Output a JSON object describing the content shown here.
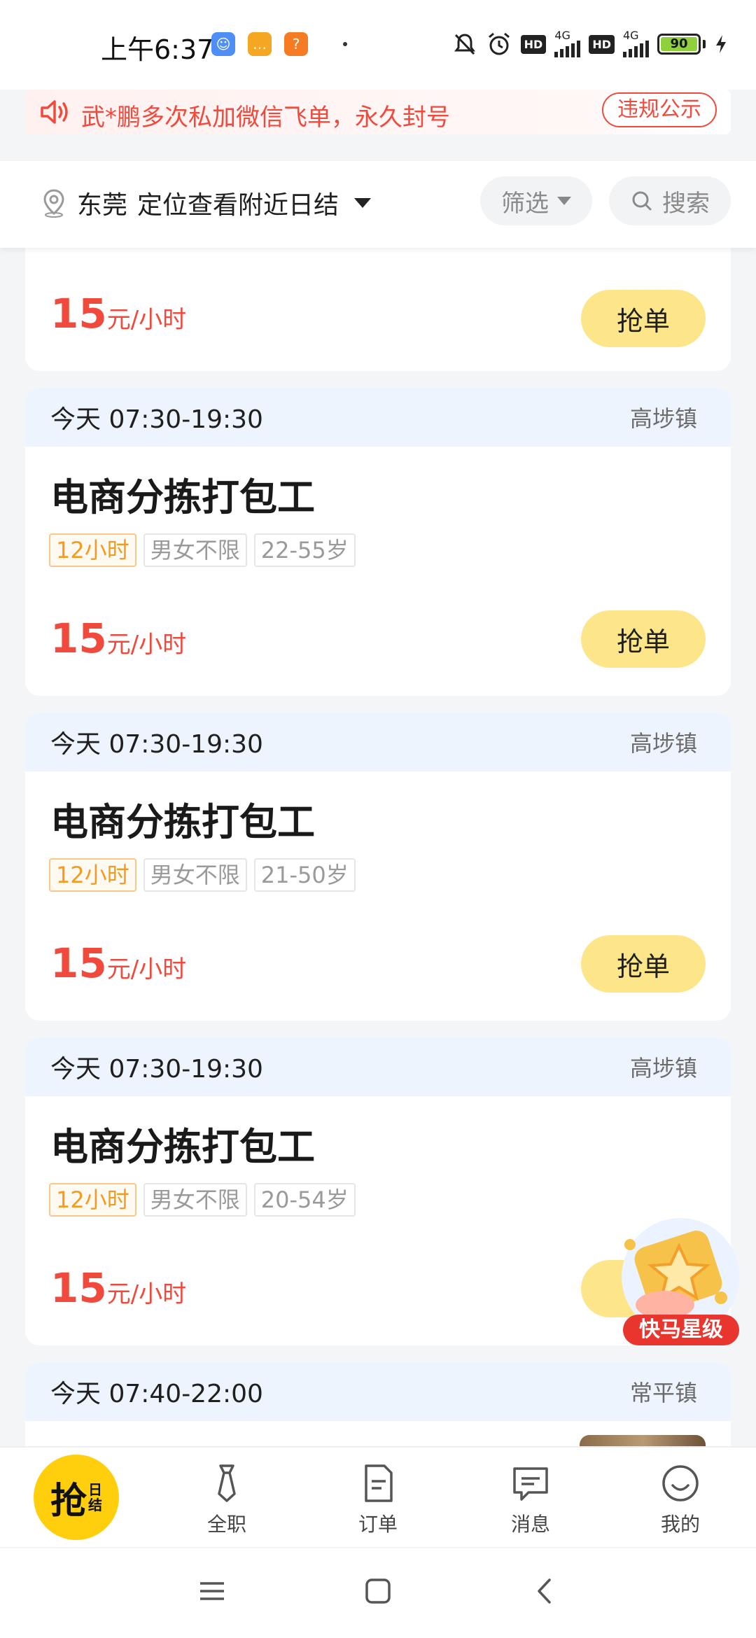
{
  "status_bar": {
    "time": "上午6:37",
    "network_1": "4G",
    "network_2": "4G",
    "hd_1": "HD",
    "hd_2": "HD",
    "battery": "90"
  },
  "notice": {
    "text": "武*鹏多次私加微信飞单，永久封号",
    "button": "违规公示"
  },
  "filter": {
    "city": "东莞",
    "location_text": "定位查看附近日结",
    "filter_label": "筛选",
    "search_label": "搜索"
  },
  "jobs": [
    {
      "price": "15",
      "unit": "元/小时",
      "action": "抢单"
    },
    {
      "time": "今天 07:30-19:30",
      "town": "高埗镇",
      "title": "电商分拣打包工",
      "tags": [
        "12小时",
        "男女不限",
        "22-55岁"
      ],
      "price": "15",
      "unit": "元/小时",
      "action": "抢单"
    },
    {
      "time": "今天 07:30-19:30",
      "town": "高埗镇",
      "title": "电商分拣打包工",
      "tags": [
        "12小时",
        "男女不限",
        "21-50岁"
      ],
      "price": "15",
      "unit": "元/小时",
      "action": "抢单"
    },
    {
      "time": "今天 07:30-19:30",
      "town": "高埗镇",
      "title": "电商分拣打包工",
      "tags": [
        "12小时",
        "男女不限",
        "20-54岁"
      ],
      "price": "15",
      "unit": "元/小时",
      "action": "抢单"
    },
    {
      "time": "今天 07:40-22:00",
      "town": "常平镇"
    }
  ],
  "float_badge": {
    "label": "快马星级"
  },
  "bottom_nav": {
    "main_big": "抢",
    "main_small_1": "日",
    "main_small_2": "结",
    "items": [
      {
        "label": "全职",
        "icon": "tie-icon"
      },
      {
        "label": "订单",
        "icon": "document-icon"
      },
      {
        "label": "消息",
        "icon": "message-icon"
      },
      {
        "label": "我的",
        "icon": "smile-icon"
      }
    ]
  },
  "colors": {
    "accent_red": "#f04a3d",
    "grab_yellow": "#fde68a",
    "nav_yellow": "#ffcf0d",
    "tag_orange": "#f39b1e",
    "card_head_blue": "#eef4fd"
  }
}
